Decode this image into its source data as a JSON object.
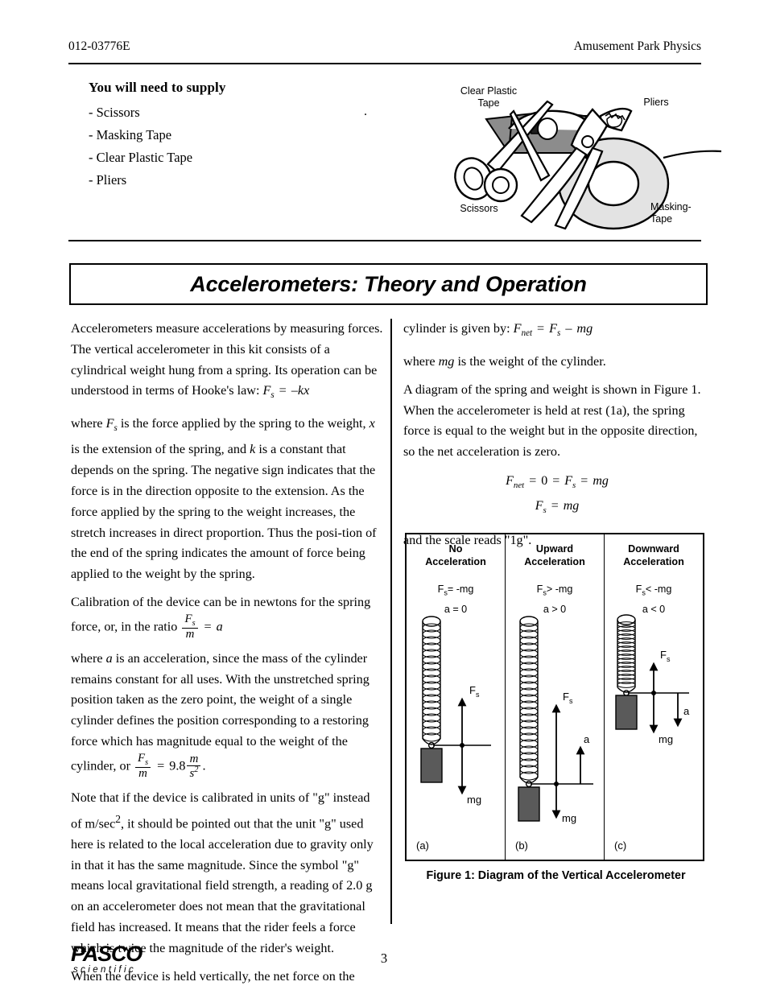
{
  "header": {
    "doc_number": "012-03776E",
    "running_title": "Amusement Park Physics"
  },
  "supply": {
    "heading": "You will need to supply",
    "items": [
      "- Scissors",
      "- Masking Tape",
      "- Clear Plastic Tape",
      "- Pliers"
    ],
    "stray_mark": "."
  },
  "illustration": {
    "labels": {
      "clear_plastic_tape": "Clear Plastic\nTape",
      "pliers": "Pliers",
      "scissors": "Scissors",
      "masking_tape": "Masking-\nTape"
    }
  },
  "banner": {
    "title": "Accelerometers: Theory and Operation"
  },
  "left_column": {
    "p1_a": "Accelerometers measure accelerations by measuring forces. The vertical accelerometer in this kit consists of a cylindrical weight hung from a spring. Its operation can be understood in terms of Hooke's law: ",
    "eq_hooke": "F_s = –kx",
    "p2": "where F_s is the force applied by the spring to the weight, x is the extension of the spring, and k is a constant that depends on the spring. The negative sign indicates that the force is in the direction opposite to the extension. As the force applied by the spring to the weight increases, the stretch increases in direct proportion. Thus the position of the end of the spring indicates the amount of force being applied to the weight by the spring.",
    "p3_a": "Calibration of the device can be in newtons for the spring force, or, in the ratio ",
    "eq_ratio": "F_s / m = a",
    "p4_a": "where a is an acceleration, since the mass of the cylinder remains constant for all uses. With the unstretched spring position taken as the zero point, the weight of a single cylinder defines the position corresponding to a restoring force which has magnitude equal to the weight of the cylinder, or ",
    "eq_g": "F_s / m = 9.8 m/s² .",
    "p5": "Note that if the device is calibrated in units of \"g\" instead of m/sec², it should be pointed out that the unit \"g\" used here is related to the local acceleration due to gravity only in that it has the same magnitude. Since the symbol \"g\" means local gravitational field strength, a reading of 2.0 g on an accelerometer does not mean that the gravitational field has increased. It means that the rider feels a force which is twice the magnitude of the rider's weight.",
    "p6": "When the device is held vertically, the net force on the"
  },
  "right_column": {
    "p1_a": "cylinder is given by: ",
    "eq_fnet": "F_net = F_s – mg",
    "p2": "where mg is the weight of the cylinder.",
    "p3": "A diagram of the spring and weight is shown in Figure 1. When the accelerometer is held at rest (1a), the spring force is equal to the weight but in the opposite direction, so the net acceleration is zero.",
    "eq_line1": "F_net = 0 = F_s = mg",
    "eq_line2": "F_s = mg",
    "p4": "and the scale reads \"1g\"."
  },
  "figure": {
    "caption": "Figure 1: Diagram of the Vertical Accelerometer",
    "panels": [
      {
        "title_line1": "No",
        "title_line2": "Acceleration",
        "eq1_pre": "F",
        "eq1_sub": "s",
        "eq1_post": "= -mg",
        "eq2": "a = 0",
        "panel_label": "(a)",
        "force_label": "F",
        "force_sub": "s",
        "weight_label": "mg",
        "accel_label": "",
        "spring_state": "rest",
        "accel_direction": "none"
      },
      {
        "title_line1": "Upward",
        "title_line2": "Acceleration",
        "eq1_pre": "F",
        "eq1_sub": "s",
        "eq1_post": "> -mg",
        "eq2": "a > 0",
        "panel_label": "(b)",
        "force_label": "F",
        "force_sub": "s",
        "weight_label": "mg",
        "accel_label": "a",
        "spring_state": "stretched",
        "accel_direction": "up"
      },
      {
        "title_line1": "Downward",
        "title_line2": "Acceleration",
        "eq1_pre": "F",
        "eq1_sub": "s",
        "eq1_post": "< -mg",
        "eq2": "a < 0",
        "panel_label": "(c)",
        "force_label": "F",
        "force_sub": "s",
        "weight_label": "mg",
        "accel_label": "a",
        "spring_state": "compressed",
        "accel_direction": "down"
      }
    ]
  },
  "footer": {
    "logo_word": "PASCO",
    "logo_sub": "scientific",
    "page_number": "3"
  },
  "colors": {
    "ink": "#000000",
    "weight_fill": "#5a5a5a",
    "tape_gray": "#8c8c8c",
    "roll_gray": "#d9d9d9"
  }
}
